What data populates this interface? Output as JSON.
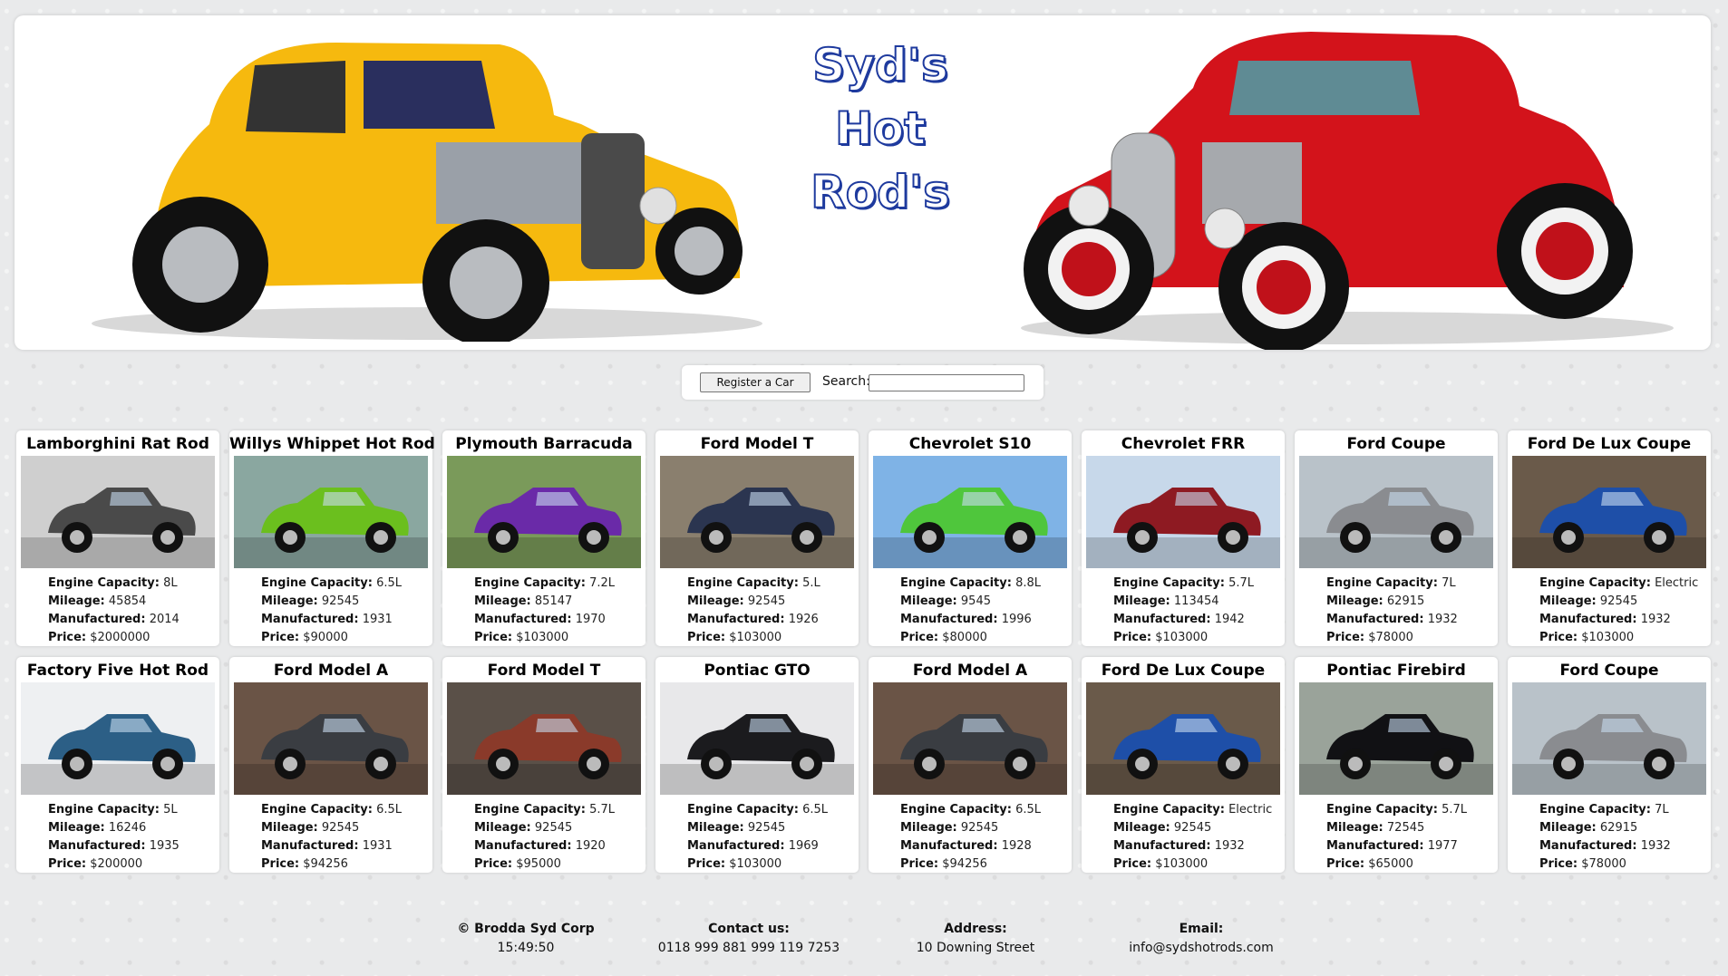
{
  "site": {
    "title_lines": [
      "Syd's",
      "Hot",
      "Rod's"
    ]
  },
  "controls": {
    "register_label": "Register a Car",
    "search_label": "Search:",
    "search_value": ""
  },
  "spec_labels": {
    "engine": "Engine Capacity:",
    "mileage": "Mileage:",
    "manufactured": "Manufactured:",
    "price": "Price:"
  },
  "cars": [
    {
      "name": "Lamborghini Rat Rod",
      "engine": "8L",
      "mileage": "45854",
      "manufactured": "2014",
      "price": "$2000000",
      "color": "#4a4a4a",
      "bg": "#cfcfcf"
    },
    {
      "name": "Willys Whippet Hot Rod",
      "engine": "6.5L",
      "mileage": "92545",
      "manufactured": "1931",
      "price": "$90000",
      "color": "#6bbf1e",
      "bg": "#8aa7a0"
    },
    {
      "name": "Plymouth Barracuda",
      "engine": "7.2L",
      "mileage": "85147",
      "manufactured": "1970",
      "price": "$103000",
      "color": "#6a2aa8",
      "bg": "#7a9a5a"
    },
    {
      "name": "Ford Model T",
      "engine": "5.L",
      "mileage": "92545",
      "manufactured": "1926",
      "price": "$103000",
      "color": "#2b3550",
      "bg": "#8a7f6e"
    },
    {
      "name": "Chevrolet S10",
      "engine": "8.8L",
      "mileage": "9545",
      "manufactured": "1996",
      "price": "$80000",
      "color": "#4fc63c",
      "bg": "#7fb3e6"
    },
    {
      "name": "Chevrolet FRR",
      "engine": "5.7L",
      "mileage": "113454",
      "manufactured": "1942",
      "price": "$103000",
      "color": "#8e1a22",
      "bg": "#c7d8ea"
    },
    {
      "name": "Ford Coupe",
      "engine": "7L",
      "mileage": "62915",
      "manufactured": "1932",
      "price": "$78000",
      "color": "#8a8c90",
      "bg": "#b9c2c9"
    },
    {
      "name": "Ford De Lux Coupe",
      "engine": "Electric",
      "mileage": "92545",
      "manufactured": "1932",
      "price": "$103000",
      "color": "#1e4fa8",
      "bg": "#6a5a4a"
    },
    {
      "name": "Factory Five Hot Rod",
      "engine": "5L",
      "mileage": "16246",
      "manufactured": "1935",
      "price": "$200000",
      "color": "#2c5f86",
      "bg": "#eef0f2"
    },
    {
      "name": "Ford Model A",
      "engine": "6.5L",
      "mileage": "92545",
      "manufactured": "1931",
      "price": "$94256",
      "color": "#3a3d42",
      "bg": "#6a5446"
    },
    {
      "name": "Ford Model T",
      "engine": "5.7L",
      "mileage": "92545",
      "manufactured": "1920",
      "price": "$95000",
      "color": "#8a3a2a",
      "bg": "#5a5048"
    },
    {
      "name": "Pontiac GTO",
      "engine": "6.5L",
      "mileage": "92545",
      "manufactured": "1969",
      "price": "$103000",
      "color": "#1b1b1e",
      "bg": "#e8e8ea"
    },
    {
      "name": "Ford Model A",
      "engine": "6.5L",
      "mileage": "92545",
      "manufactured": "1928",
      "price": "$94256",
      "color": "#3a3d42",
      "bg": "#6a5446"
    },
    {
      "name": "Ford De Lux Coupe",
      "engine": "Electric",
      "mileage": "92545",
      "manufactured": "1932",
      "price": "$103000",
      "color": "#1e4fa8",
      "bg": "#6a5a4a"
    },
    {
      "name": "Pontiac Firebird",
      "engine": "5.7L",
      "mileage": "72545",
      "manufactured": "1977",
      "price": "$65000",
      "color": "#111114",
      "bg": "#9aa39a"
    },
    {
      "name": "Ford Coupe",
      "engine": "7L",
      "mileage": "62915",
      "manufactured": "1932",
      "price": "$78000",
      "color": "#8a8c90",
      "bg": "#b9c2c9"
    }
  ],
  "footer": {
    "company": "© Brodda Syd Corp",
    "time": "15:49:50",
    "contact_label": "Contact us:",
    "contact_value": "0118 999 881 999 119 7253",
    "address_label": "Address:",
    "address_value": "10 Downing Street",
    "email_label": "Email:",
    "email_value": "info@sydshotrods.com"
  },
  "colors": {
    "title_blue": "#1e3a9e",
    "banner_left_car": "#f6b90e",
    "banner_right_car": "#d3131b"
  }
}
